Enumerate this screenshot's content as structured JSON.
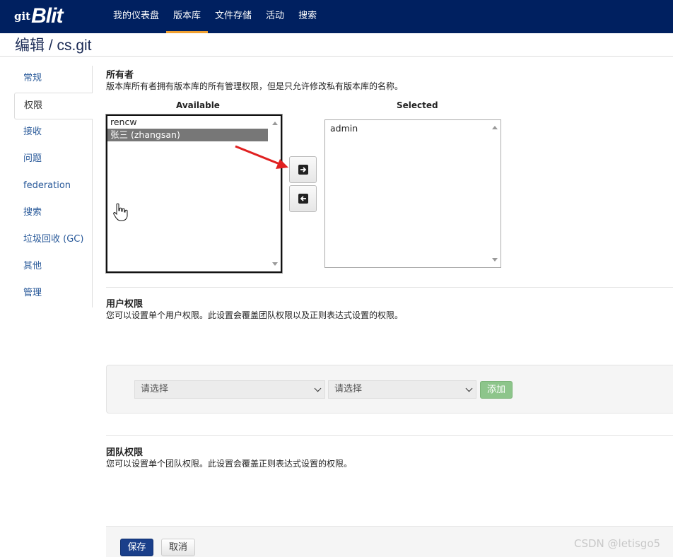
{
  "brand": {
    "prefix": "git",
    "name": "Blit"
  },
  "nav": {
    "items": [
      {
        "label": "我的仪表盘"
      },
      {
        "label": "版本库"
      },
      {
        "label": "文件存储"
      },
      {
        "label": "活动"
      },
      {
        "label": "搜索"
      }
    ],
    "active_index": 1
  },
  "page": {
    "title": "编辑 / cs.git"
  },
  "sidebar": {
    "items": [
      {
        "label": "常规"
      },
      {
        "label": "权限"
      },
      {
        "label": "接收"
      },
      {
        "label": "问题"
      },
      {
        "label": "federation"
      },
      {
        "label": "搜索"
      },
      {
        "label": "垃圾回收 (GC)"
      },
      {
        "label": "其他"
      },
      {
        "label": "管理"
      }
    ],
    "active_index": 1
  },
  "owners": {
    "title": "所有者",
    "description": "版本库所有者拥有版本库的所有管理权限，但是只允许修改私有版本库的名称。",
    "available_label": "Available",
    "selected_label": "Selected",
    "available": [
      {
        "label": "rencw"
      },
      {
        "label": "张三 (zhangsan)"
      }
    ],
    "available_selected_index": 1,
    "selected": [
      {
        "label": "admin"
      }
    ],
    "move_right_icon": "arrow-right-icon",
    "move_left_icon": "arrow-left-icon"
  },
  "user_permissions": {
    "title": "用户权限",
    "description": "您可以设置单个用户权限。此设置会覆盖团队权限以及正则表达式设置的权限。",
    "select1": "请选择",
    "select2": "请选择",
    "add_label": "添加"
  },
  "team_permissions": {
    "title": "团队权限",
    "description": "您可以设置单个团队权限。此设置会覆盖正则表达式设置的权限。"
  },
  "actions": {
    "save_label": "保存",
    "cancel_label": "取消"
  },
  "watermark": "CSDN @letisgo5",
  "colors": {
    "navbar": "#002060",
    "accent": "#f0a030",
    "save": "#1a3f8a",
    "add": "#8dc58b",
    "annotation_arrow": "#e02020"
  }
}
